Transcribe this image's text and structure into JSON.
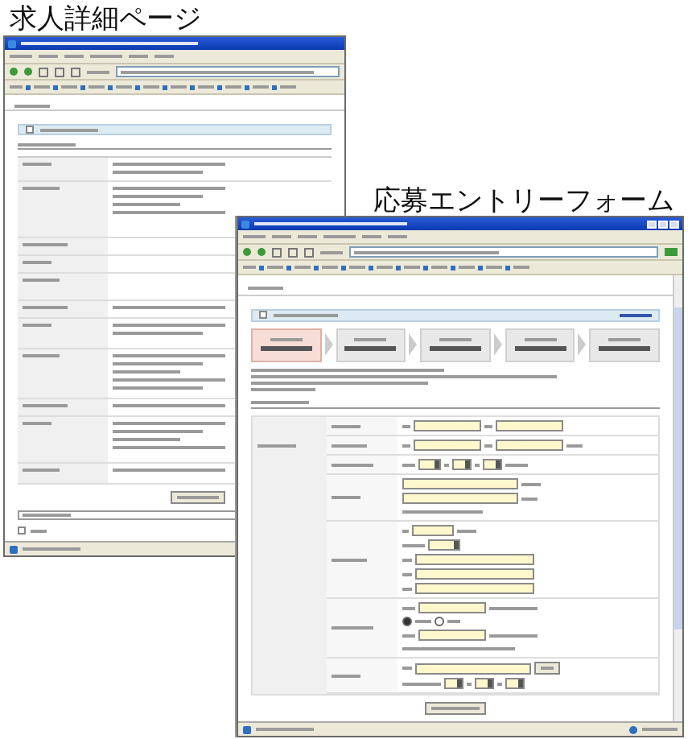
{
  "detail_page": {
    "heading": "求人詳細ページ",
    "other_conditions": [
      {
        "checked": false
      }
    ]
  },
  "entry_form": {
    "heading": "応募エントリーフォーム",
    "steps": [
      {
        "selected": true
      },
      {
        "selected": false
      },
      {
        "selected": false
      },
      {
        "selected": false
      },
      {
        "selected": false
      }
    ],
    "phone_contact": [
      {
        "selected": true
      },
      {
        "selected": false
      }
    ]
  }
}
